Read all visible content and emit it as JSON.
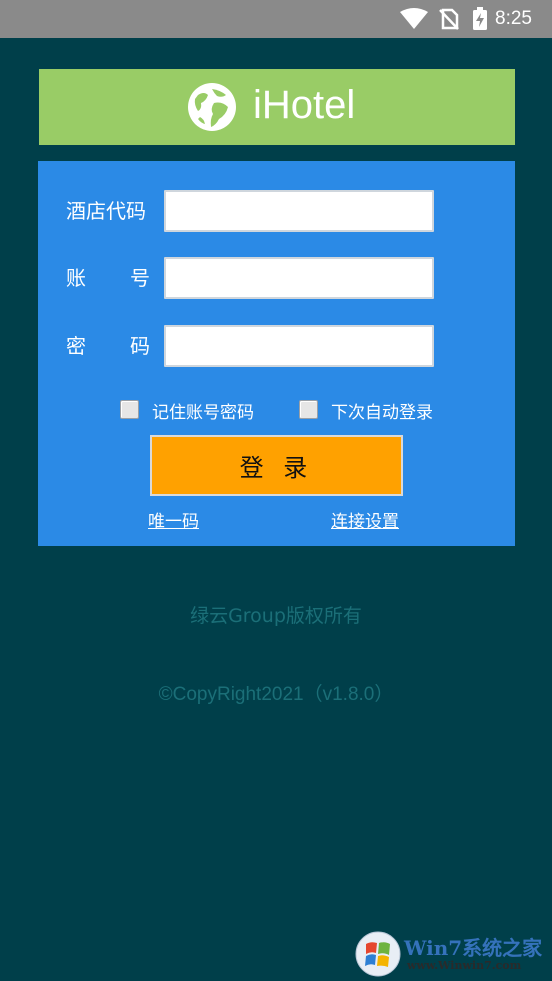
{
  "status_bar": {
    "time": "8:25",
    "icons": [
      "wifi-icon",
      "no-sim-icon",
      "battery-charging-icon"
    ]
  },
  "banner": {
    "app_name": "iHotel",
    "logo_icon": "globe-icon",
    "background": "#99cc66"
  },
  "login_form": {
    "hotel_code_label": "酒店代码",
    "account_label": [
      "账",
      "号"
    ],
    "password_label": [
      "密",
      "码"
    ],
    "hotel_code_value": "",
    "account_value": "",
    "password_value": "",
    "remember_label": "记住账号密码",
    "auto_login_label": "下次自动登录",
    "login_button": "登 录",
    "unique_code_link": "唯一码",
    "connection_settings_link": "连接设置",
    "card_color": "#2b8ae6",
    "button_color": "#ffa100"
  },
  "footer": {
    "owner": "绿云Group版权所有",
    "copyright": "©CopyRight2021（v1.8.0）"
  },
  "watermark": {
    "title": "Win7系统之家",
    "url": "www.Winwin7.com"
  },
  "colors": {
    "background": "#003f4a",
    "status_bar": "#8a8a8a",
    "footer_text": "#1b6f78"
  }
}
